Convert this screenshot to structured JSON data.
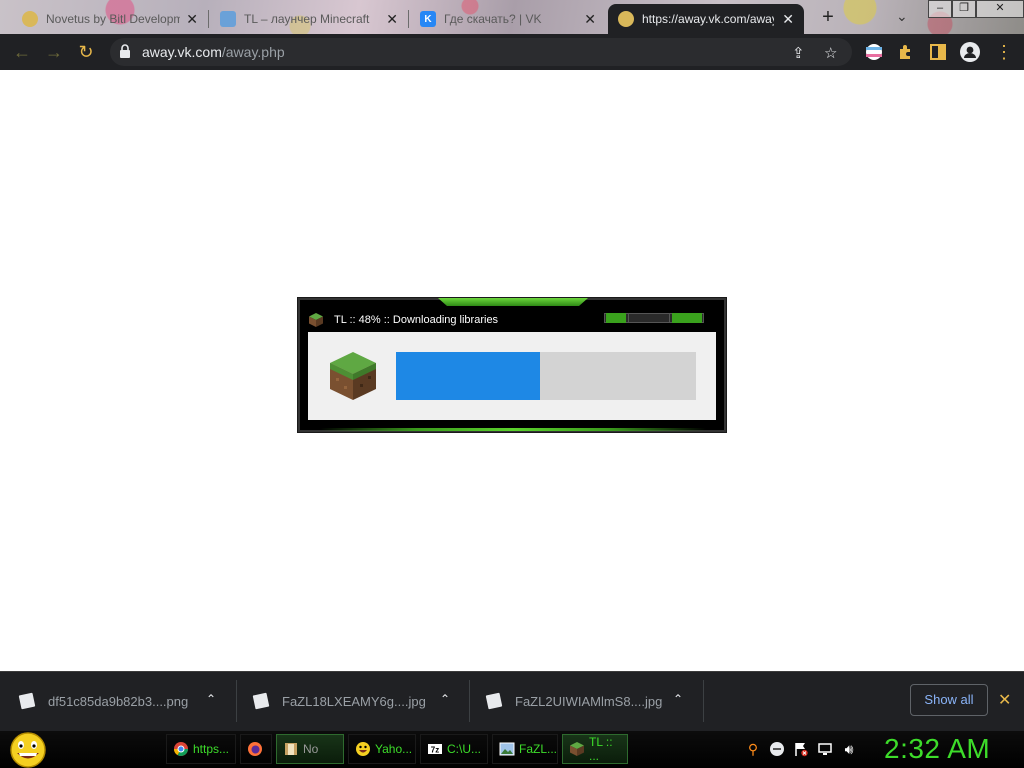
{
  "browser": {
    "tabs": [
      {
        "title": "Novetus by Bitl Developm",
        "favicon": "novetus-icon"
      },
      {
        "title": "TL – лаунчер Minecraft",
        "favicon": "tl-launcher-icon"
      },
      {
        "title": "Где скачать? | VK",
        "favicon": "vk-icon"
      },
      {
        "title": "https://away.vk.com/away",
        "favicon": "away-icon"
      }
    ],
    "new_tab": "+",
    "url_host": "away.vk.com",
    "url_path": "/away.php",
    "window_controls": {
      "minimize": "–",
      "restore": "❐",
      "close": "✕"
    }
  },
  "launcher": {
    "title": "TL :: 48% :: Downloading libraries",
    "progress_percent": 48
  },
  "downloads": {
    "items": [
      {
        "name": "df51c85da9b82b3....png"
      },
      {
        "name": "FaZL18LXEAMY6g....jpg"
      },
      {
        "name": "FaZL2UIWIAMlmS8....jpg"
      }
    ],
    "show_all": "Show all",
    "close": "✕"
  },
  "taskbar": {
    "tasks": [
      {
        "label": "https...",
        "icon": "chrome-icon"
      },
      {
        "label": "",
        "icon": "firefox-icon"
      },
      {
        "label": "No",
        "icon": "explorer-icon"
      },
      {
        "label": "Yaho...",
        "icon": "yahoo-messenger-icon"
      },
      {
        "label": "C:\\U...",
        "icon": "7zip-icon"
      },
      {
        "label": "FaZL...",
        "icon": "image-viewer-icon"
      },
      {
        "label": "TL :: ...",
        "icon": "minecraft-block-icon"
      }
    ],
    "clock": "2:32 AM"
  },
  "colors": {
    "progress_fill": "#1e88e5",
    "taskbar_text": "#3ddc2a",
    "show_all_text": "#8ab4f8"
  }
}
